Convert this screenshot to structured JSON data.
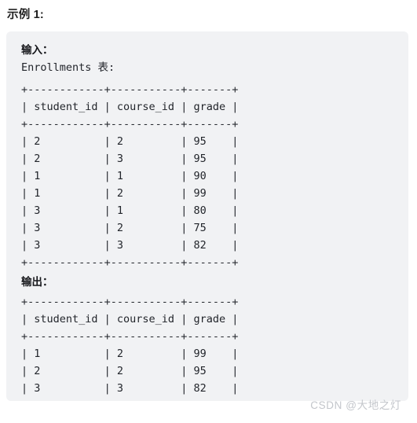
{
  "page": {
    "example_title": "示例 1:"
  },
  "code_block": {
    "input_label": "输入：",
    "input_table_caption": "Enrollments 表:",
    "output_label": "输出：",
    "input_table": {
      "top_border": "+------------+-----------+-------+",
      "header": "| student_id | course_id | grade |",
      "header_sep": "+------------+-----------+-------+",
      "rows": [
        "| 2          | 2         | 95    |",
        "| 2          | 3         | 95    |",
        "| 1          | 1         | 90    |",
        "| 1          | 2         | 99    |",
        "| 3          | 1         | 80    |",
        "| 3          | 2         | 75    |",
        "| 3          | 3         | 82    |"
      ],
      "bottom_border": "+------------+-----------+-------+",
      "columns": [
        "student_id",
        "course_id",
        "grade"
      ],
      "data": [
        [
          2,
          2,
          95
        ],
        [
          2,
          3,
          95
        ],
        [
          1,
          1,
          90
        ],
        [
          1,
          2,
          99
        ],
        [
          3,
          1,
          80
        ],
        [
          3,
          2,
          75
        ],
        [
          3,
          3,
          82
        ]
      ]
    },
    "output_table": {
      "top_border": "+------------+-----------+-------+",
      "header": "| student_id | course_id | grade |",
      "header_sep": "+------------+-----------+-------+",
      "rows": [
        "| 1          | 2         | 99    |",
        "| 2          | 2         | 95    |",
        "| 3          | 3         | 82    |"
      ],
      "bottom_border": "+------------+-----------+-------+",
      "columns": [
        "student_id",
        "course_id",
        "grade"
      ],
      "data": [
        [
          1,
          2,
          99
        ],
        [
          2,
          2,
          95
        ],
        [
          3,
          3,
          82
        ]
      ]
    }
  },
  "watermark": {
    "text": "CSDN @大地之灯"
  },
  "colors": {
    "page_background": "#ffffff",
    "code_background": "#f1f2f4",
    "code_text": "#22252b",
    "title_text": "#1f1f1f",
    "watermark_text": "#c3c6cb"
  }
}
